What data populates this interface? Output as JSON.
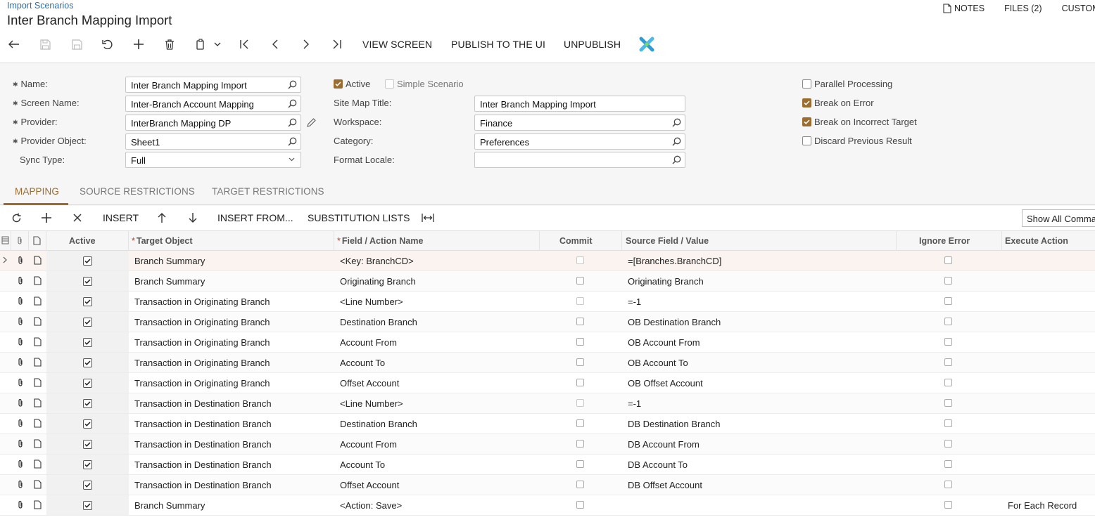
{
  "header": {
    "breadcrumb": "Import Scenarios",
    "title": "Inter Branch Mapping Import",
    "top_right": {
      "notes": "NOTES",
      "files": "FILES (2)",
      "customization": "CUSTOM"
    }
  },
  "toolbar": {
    "icons": [
      "back-icon",
      "save-icon",
      "save-close-icon",
      "undo-icon",
      "add-icon",
      "delete-icon",
      "copy-paste-icon",
      "first-icon",
      "previous-icon",
      "next-icon",
      "last-icon"
    ],
    "view_screen": "VIEW SCREEN",
    "publish": "PUBLISH TO THE UI",
    "unpublish": "UNPUBLISH"
  },
  "form": {
    "name_label": "Name:",
    "name_value": "Inter Branch Mapping Import",
    "screen_name_label": "Screen Name:",
    "screen_name_value": "Inter-Branch Account Mapping",
    "provider_label": "Provider:",
    "provider_value": "InterBranch Mapping DP",
    "provider_object_label": "Provider Object:",
    "provider_object_value": "Sheet1",
    "sync_type_label": "Sync Type:",
    "sync_type_value": "Full",
    "active_label": "Active",
    "active_checked": true,
    "simple_scenario_label": "Simple Scenario",
    "simple_scenario_checked": false,
    "site_map_title_label": "Site Map Title:",
    "site_map_title_value": "Inter Branch Mapping Import",
    "workspace_label": "Workspace:",
    "workspace_value": "Finance",
    "category_label": "Category:",
    "category_value": "Preferences",
    "format_locale_label": "Format Locale:",
    "format_locale_value": "",
    "parallel_processing_label": "Parallel Processing",
    "parallel_processing_checked": false,
    "break_on_error_label": "Break on Error",
    "break_on_error_checked": true,
    "break_on_incorrect_target_label": "Break on Incorrect Target",
    "break_on_incorrect_target_checked": true,
    "discard_previous_result_label": "Discard Previous Result",
    "discard_previous_result_checked": false
  },
  "tabs": {
    "mapping": "MAPPING",
    "source_restrictions": "SOURCE RESTRICTIONS",
    "target_restrictions": "TARGET RESTRICTIONS",
    "active_tab": "MAPPING"
  },
  "grid_toolbar": {
    "insert": "INSERT",
    "insert_from": "INSERT FROM...",
    "substitution_lists": "SUBSTITUTION LISTS",
    "show_all": "Show All Commands"
  },
  "grid": {
    "columns": {
      "active": "Active",
      "target_object": "Target Object",
      "field_action": "Field / Action Name",
      "commit": "Commit",
      "source_field": "Source Field / Value",
      "ignore_error": "Ignore Error",
      "execute_action": "Execute Action"
    },
    "rows": [
      {
        "active": true,
        "target_object": "Branch Summary",
        "field_action": "<Key: BranchCD>",
        "commit": false,
        "commit_disabled": true,
        "source_field": "=[Branches.BranchCD]",
        "ignore_error": false,
        "execute_action": ""
      },
      {
        "active": true,
        "target_object": "Branch Summary",
        "field_action": "Originating Branch",
        "commit": false,
        "commit_disabled": false,
        "source_field": "Originating Branch",
        "ignore_error": false,
        "execute_action": ""
      },
      {
        "active": true,
        "target_object": "Transaction in Originating Branch",
        "field_action": "<Line Number>",
        "commit": false,
        "commit_disabled": true,
        "source_field": "=-1",
        "ignore_error": false,
        "execute_action": ""
      },
      {
        "active": true,
        "target_object": "Transaction in Originating Branch",
        "field_action": "Destination Branch",
        "commit": false,
        "commit_disabled": false,
        "source_field": "OB Destination Branch",
        "ignore_error": false,
        "execute_action": ""
      },
      {
        "active": true,
        "target_object": "Transaction in Originating Branch",
        "field_action": "Account From",
        "commit": false,
        "commit_disabled": false,
        "source_field": "OB Account From",
        "ignore_error": false,
        "execute_action": ""
      },
      {
        "active": true,
        "target_object": "Transaction in Originating Branch",
        "field_action": "Account To",
        "commit": false,
        "commit_disabled": false,
        "source_field": "OB Account To",
        "ignore_error": false,
        "execute_action": ""
      },
      {
        "active": true,
        "target_object": "Transaction in Originating Branch",
        "field_action": "Offset Account",
        "commit": false,
        "commit_disabled": false,
        "source_field": "OB Offset Account",
        "ignore_error": false,
        "execute_action": ""
      },
      {
        "active": true,
        "target_object": "Transaction in Destination Branch",
        "field_action": "<Line Number>",
        "commit": false,
        "commit_disabled": true,
        "source_field": "=-1",
        "ignore_error": false,
        "execute_action": ""
      },
      {
        "active": true,
        "target_object": "Transaction in Destination Branch",
        "field_action": "Destination Branch",
        "commit": false,
        "commit_disabled": false,
        "source_field": "DB Destination Branch",
        "ignore_error": false,
        "execute_action": ""
      },
      {
        "active": true,
        "target_object": "Transaction in Destination Branch",
        "field_action": "Account From",
        "commit": false,
        "commit_disabled": false,
        "source_field": "DB Account From",
        "ignore_error": false,
        "execute_action": ""
      },
      {
        "active": true,
        "target_object": "Transaction in Destination Branch",
        "field_action": "Account To",
        "commit": false,
        "commit_disabled": false,
        "source_field": "DB Account To",
        "ignore_error": false,
        "execute_action": ""
      },
      {
        "active": true,
        "target_object": "Transaction in Destination Branch",
        "field_action": "Offset Account",
        "commit": false,
        "commit_disabled": false,
        "source_field": "DB Offset Account",
        "ignore_error": false,
        "execute_action": ""
      },
      {
        "active": true,
        "target_object": "Branch Summary",
        "field_action": "<Action: Save>",
        "commit": false,
        "commit_disabled": false,
        "source_field": "",
        "ignore_error": false,
        "execute_action": "For Each Record"
      }
    ]
  },
  "colors": {
    "accent": "#9b6b2f",
    "link": "#2b6dad",
    "required": "#c0392b"
  }
}
